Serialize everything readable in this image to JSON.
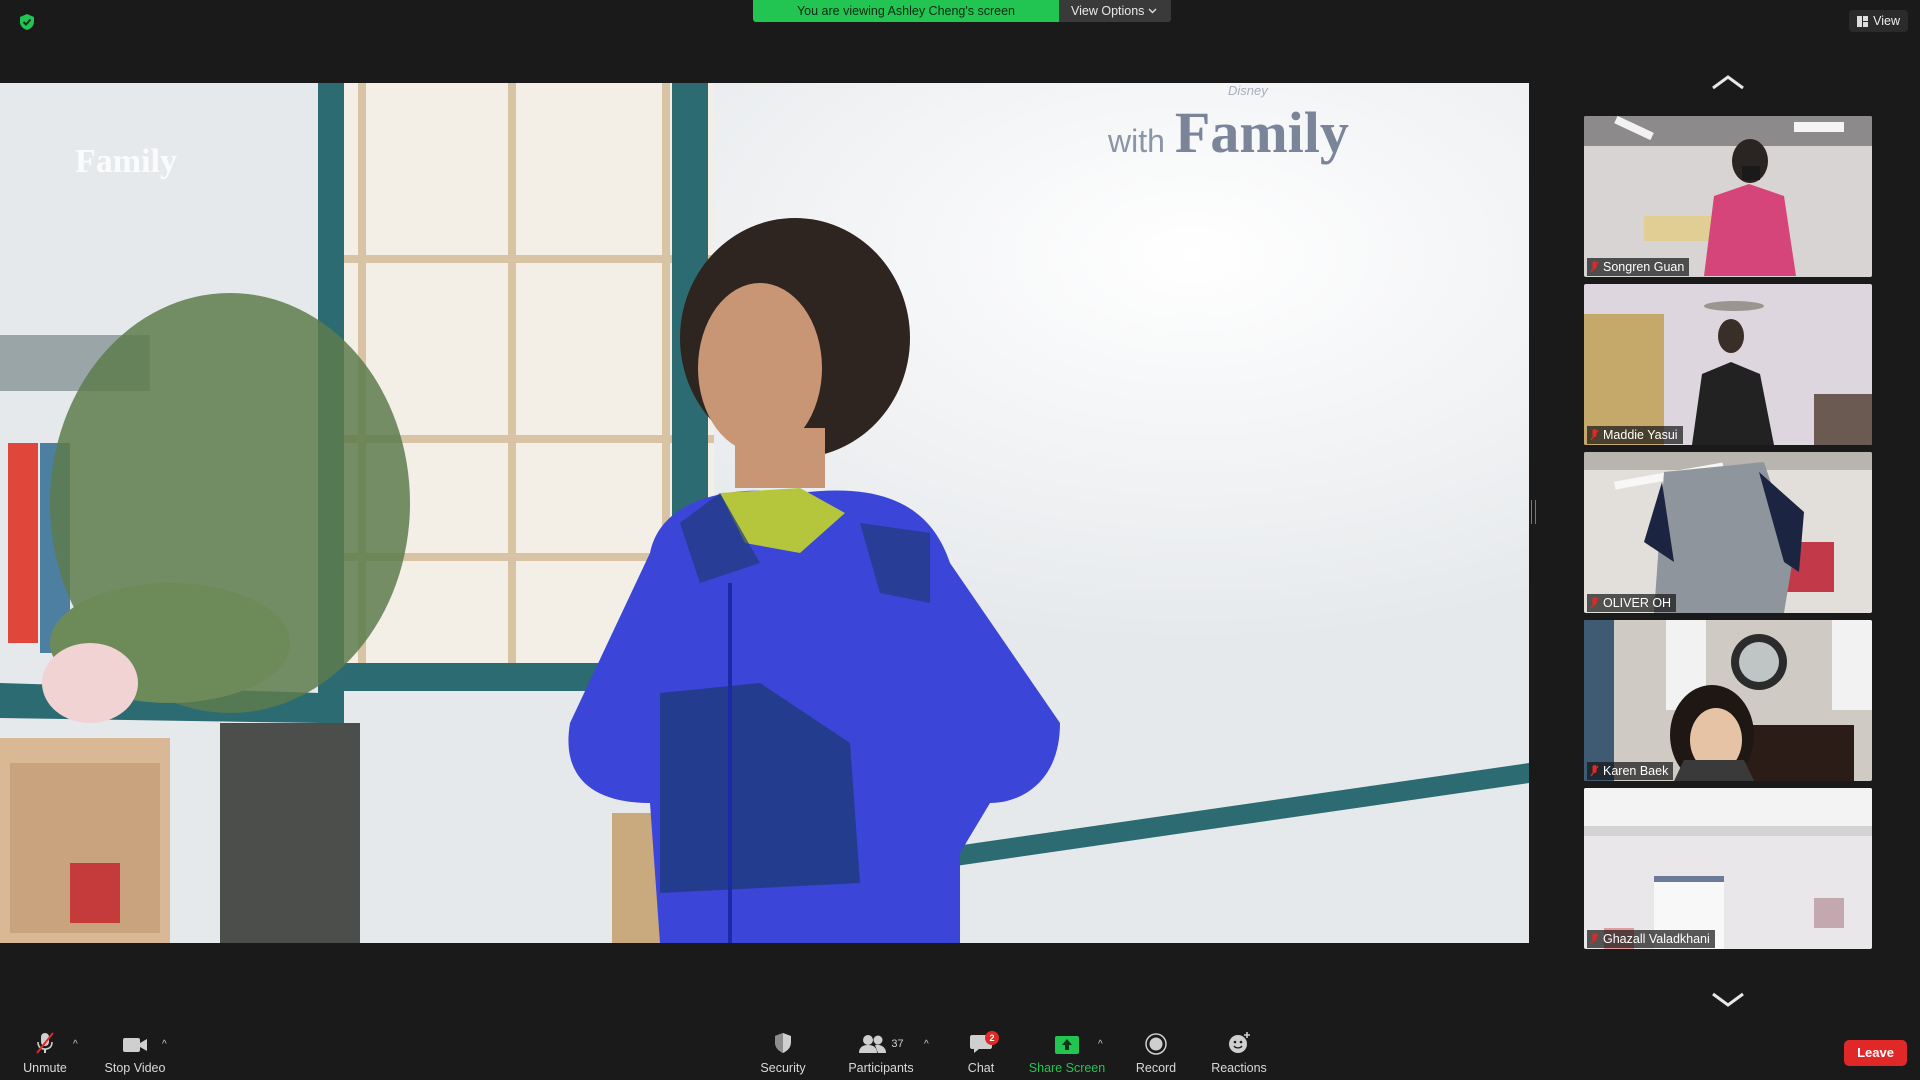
{
  "banner": {
    "text": "You are viewing Ashley Cheng's screen",
    "options_label": "View Options"
  },
  "view_button": {
    "label": "View"
  },
  "shared_screen": {
    "watermark_left": "Family",
    "watermark_right_small": "with",
    "watermark_right_large": "Family",
    "watermark_brand": "Disney"
  },
  "participants_tiles": [
    {
      "name": "Songren Guan"
    },
    {
      "name": "Maddie Yasui"
    },
    {
      "name": "OLIVER OH"
    },
    {
      "name": "Karen Baek"
    },
    {
      "name": "Ghazall Valadkhani"
    }
  ],
  "toolbar": {
    "unmute": "Unmute",
    "stop_video": "Stop Video",
    "security": "Security",
    "participants": "Participants",
    "participants_count": "37",
    "chat": "Chat",
    "chat_badge": "2",
    "share_screen": "Share Screen",
    "record": "Record",
    "reactions": "Reactions",
    "leave": "Leave"
  },
  "colors": {
    "accent_green": "#23c552",
    "leave_red": "#e02828",
    "background": "#1a1a1a"
  }
}
